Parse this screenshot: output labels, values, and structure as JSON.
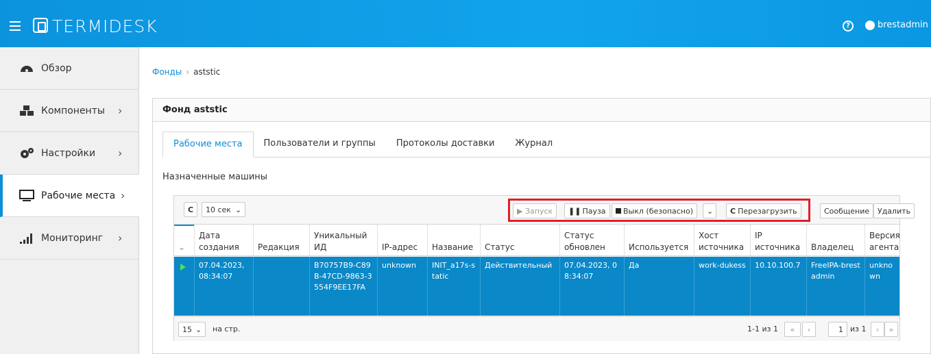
{
  "header": {
    "logo": "TERMIDESK",
    "help": "?",
    "user": "brestadmin"
  },
  "sidebar": {
    "items": [
      {
        "label": "Обзор",
        "icon": "dashboard-icon",
        "chevron": ""
      },
      {
        "label": "Компоненты",
        "icon": "components-icon",
        "chevron": "›"
      },
      {
        "label": "Настройки",
        "icon": "gears-icon",
        "chevron": "›"
      },
      {
        "label": "Рабочие места",
        "icon": "monitor-icon",
        "chevron": "›"
      },
      {
        "label": "Мониторинг",
        "icon": "bars-icon",
        "chevron": "›"
      }
    ]
  },
  "breadcrumb": {
    "root": "Фонды",
    "sep": "›",
    "current": "aststic"
  },
  "panel": {
    "title": "Фонд aststic"
  },
  "tabs": [
    "Рабочие места",
    "Пользователи и группы",
    "Протоколы доставки",
    "Журнал"
  ],
  "section_title": "Назначенные машины",
  "toolbar": {
    "refresh": "C",
    "interval": "10 сек",
    "start": "▶ Запуск",
    "pause": "Пауза",
    "shutdown": "Выкл (безопасно)",
    "dropdown": "⌄",
    "reboot": "Перезагрузить",
    "message": "Сообщение",
    "delete": "Удалить"
  },
  "columns": [
    "Дата создания",
    "Редакция",
    "Уникальный ИД",
    "IP-адрес",
    "Название",
    "Статус",
    "Статус обновлен",
    "Используется",
    "Хост источника",
    "IP источника",
    "Владелец",
    "Версия агента"
  ],
  "row": [
    "07.04.2023, 08:34:07",
    "",
    "B70757B9-C89B-47CD-9863-3554F9EE17FA",
    "unknown",
    "INIT_a17s-static",
    "Действительный",
    "07.04.2023, 08:34:07",
    "Да",
    "work-dukess",
    "10.10.100.7",
    "FreeIPA-brestadmin",
    "unknown"
  ],
  "pager": {
    "per_page": "15",
    "per_page_label": "на стр.",
    "range": "1-1 из 1",
    "first": "«",
    "prev": "‹",
    "page": "1",
    "of": "из 1",
    "next": "›",
    "last": "»"
  }
}
